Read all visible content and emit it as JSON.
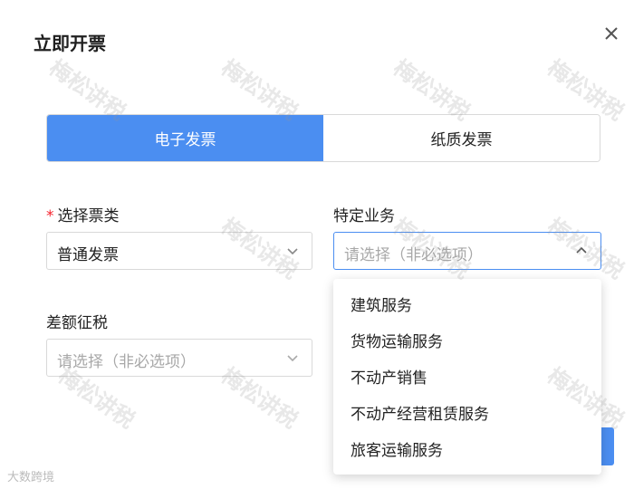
{
  "dialog": {
    "title": "立即开票",
    "close_icon": "close-icon"
  },
  "tabs": [
    {
      "label": "电子发票",
      "active": true
    },
    {
      "label": "纸质发票",
      "active": false
    }
  ],
  "fields": {
    "ticket_type": {
      "label": "选择票类",
      "required_mark": "*",
      "value": "普通发票",
      "icon": "chevron-down-icon"
    },
    "special_business": {
      "label": "特定业务",
      "placeholder": "请选择（非必选项）",
      "icon": "chevron-up-icon",
      "open": true
    },
    "differential_tax": {
      "label": "差额征税",
      "placeholder": "请选择（非必选项）",
      "icon": "chevron-down-icon"
    }
  },
  "special_business_options": [
    "建筑服务",
    "货物运输服务",
    "不动产销售",
    "不动产经营租赁服务",
    "旅客运输服务"
  ],
  "watermark": "梅松讲税",
  "corner_mark": "大数跨境",
  "colors": {
    "accent": "#4b8ef1",
    "required": "#f5222d",
    "placeholder": "#a8a8a8"
  }
}
